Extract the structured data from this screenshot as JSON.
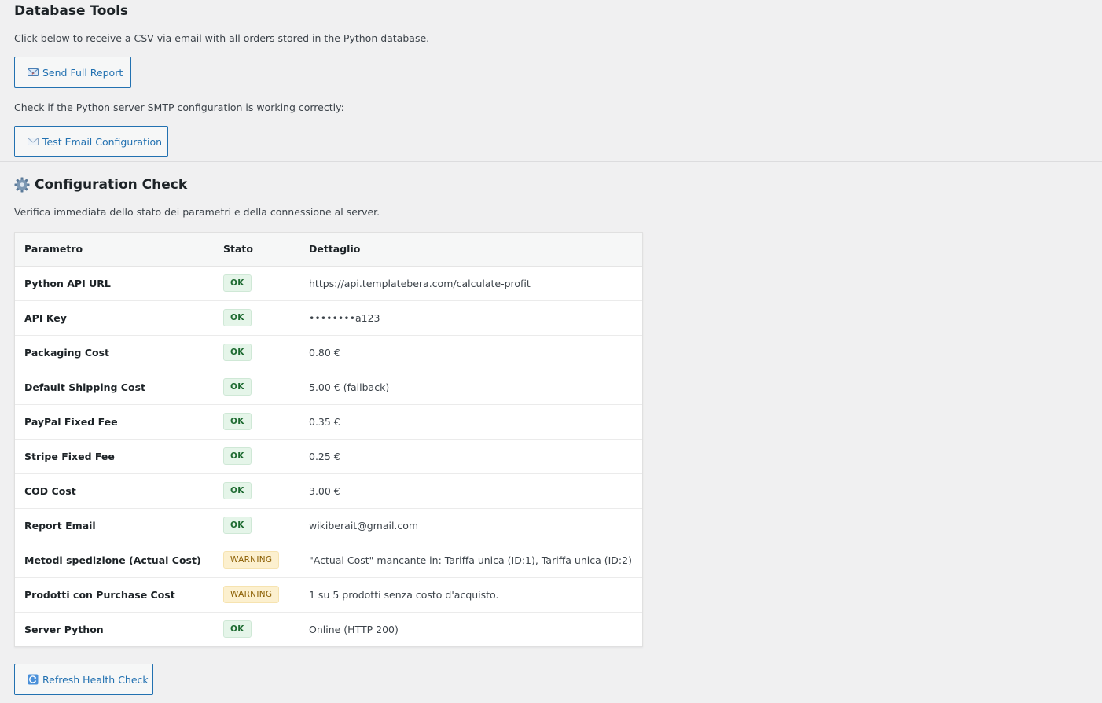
{
  "database_tools": {
    "title": "Database Tools",
    "report_desc": "Click below to receive a CSV via email with all orders stored in the Python database.",
    "report_button": "Send Full Report",
    "smtp_desc": "Check if the Python server SMTP configuration is working correctly:",
    "smtp_button": "Test Email Configuration"
  },
  "config_check": {
    "title": "Configuration Check",
    "desc": "Verifica immediata dello stato dei parametri e della connessione al server.",
    "columns": [
      "Parametro",
      "Stato",
      "Dettaglio"
    ],
    "rows": [
      {
        "param": "Python API URL",
        "status": "OK",
        "detail": "https://api.templatebera.com/calculate-profit"
      },
      {
        "param": "API Key",
        "status": "OK",
        "detail": "••••••••a123"
      },
      {
        "param": "Packaging Cost",
        "status": "OK",
        "detail": "0.80 €"
      },
      {
        "param": "Default Shipping Cost",
        "status": "OK",
        "detail": "5.00 € (fallback)"
      },
      {
        "param": "PayPal Fixed Fee",
        "status": "OK",
        "detail": "0.35 €"
      },
      {
        "param": "Stripe Fixed Fee",
        "status": "OK",
        "detail": "0.25 €"
      },
      {
        "param": "COD Cost",
        "status": "OK",
        "detail": "3.00 €"
      },
      {
        "param": "Report Email",
        "status": "OK",
        "detail": "wikiberait@gmail.com"
      },
      {
        "param": "Metodi spedizione (Actual Cost)",
        "status": "WARNING",
        "detail": "\"Actual Cost\" mancante in: Tariffa unica (ID:1), Tariffa unica (ID:2)"
      },
      {
        "param": "Prodotti con Purchase Cost",
        "status": "WARNING",
        "detail": "1 su 5 prodotti senza costo d'acquisto."
      },
      {
        "param": "Server Python",
        "status": "OK",
        "detail": "Online (HTTP 200)"
      }
    ],
    "refresh_button": "Refresh Health Check"
  },
  "colors": {
    "accent": "#2271b1",
    "ok_bg": "#e5f5e9",
    "ok_text": "#1e6b31",
    "warning_bg": "#fcf0cf",
    "warning_text": "#8a5d00"
  },
  "icons": {
    "report_button": "email-icon",
    "smtp_button": "envelope-icon",
    "config_title": "gear-icon",
    "refresh_button": "refresh-icon"
  }
}
